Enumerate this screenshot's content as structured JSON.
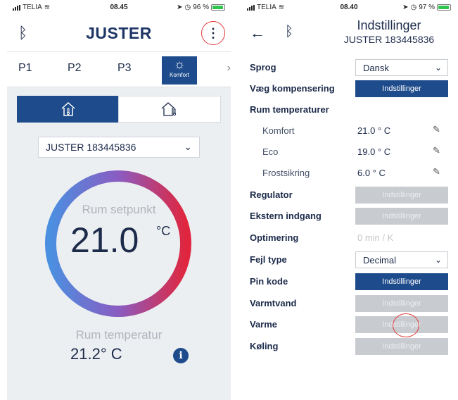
{
  "left": {
    "status": {
      "carrier": "TELIA",
      "time": "08.45",
      "battery": "96 %"
    },
    "header": {
      "title": "JUSTER",
      "bluetooth_icon": "bluetooth-icon",
      "menu_icon": "more-vertical-icon"
    },
    "tabs": [
      {
        "label": "P1"
      },
      {
        "label": "P2"
      },
      {
        "label": "P3"
      },
      {
        "label": "Komfort",
        "icon": "sun-icon",
        "active": true
      }
    ],
    "modes": {
      "home_icon": "home-thermometer-icon",
      "away_icon": "house-thermometer-icon"
    },
    "device": "JUSTER 183445836",
    "setpoint": {
      "label": "Rum setpunkt",
      "value": "21.0",
      "unit": "°C"
    },
    "room_temp": {
      "label": "Rum temperatur",
      "value": "21.2° C"
    },
    "colors": {
      "dial_cold": "#4b8fe0",
      "dial_mid": "#8a5cc2",
      "dial_hot": "#e0263e",
      "accent": "#1d4b8b"
    }
  },
  "right": {
    "status": {
      "carrier": "TELIA",
      "time": "08.40",
      "battery": "97 %"
    },
    "header": {
      "title": "Indstillinger",
      "subtitle": "JUSTER 183445836"
    },
    "rows": {
      "sprog": {
        "label": "Sprog",
        "value": "Dansk"
      },
      "vaeg": {
        "label": "Væg kompensering",
        "button": "Indstillinger"
      },
      "rum_temp": {
        "label": "Rum temperaturer"
      },
      "komfort": {
        "label": "Komfort",
        "value": "21.0 ° C"
      },
      "eco": {
        "label": "Eco",
        "value": "19.0 ° C"
      },
      "frost": {
        "label": "Frostsikring",
        "value": "6.0 ° C"
      },
      "regulator": {
        "label": "Regulator",
        "button": "Indstillinger"
      },
      "ekstern": {
        "label": "Ekstern indgang",
        "button": "Indstillinger"
      },
      "optimering": {
        "label": "Optimering",
        "value": "0 min / K"
      },
      "fejl": {
        "label": "Fejl type",
        "value": "Decimal"
      },
      "pin": {
        "label": "Pin kode",
        "button": "Indstillinger"
      },
      "varmtvand": {
        "label": "Varmtvand",
        "button": "Indstillinger"
      },
      "varme": {
        "label": "Varme",
        "button": "Indstillinger"
      },
      "koling": {
        "label": "Køling",
        "button": "Indstillinger"
      }
    }
  }
}
